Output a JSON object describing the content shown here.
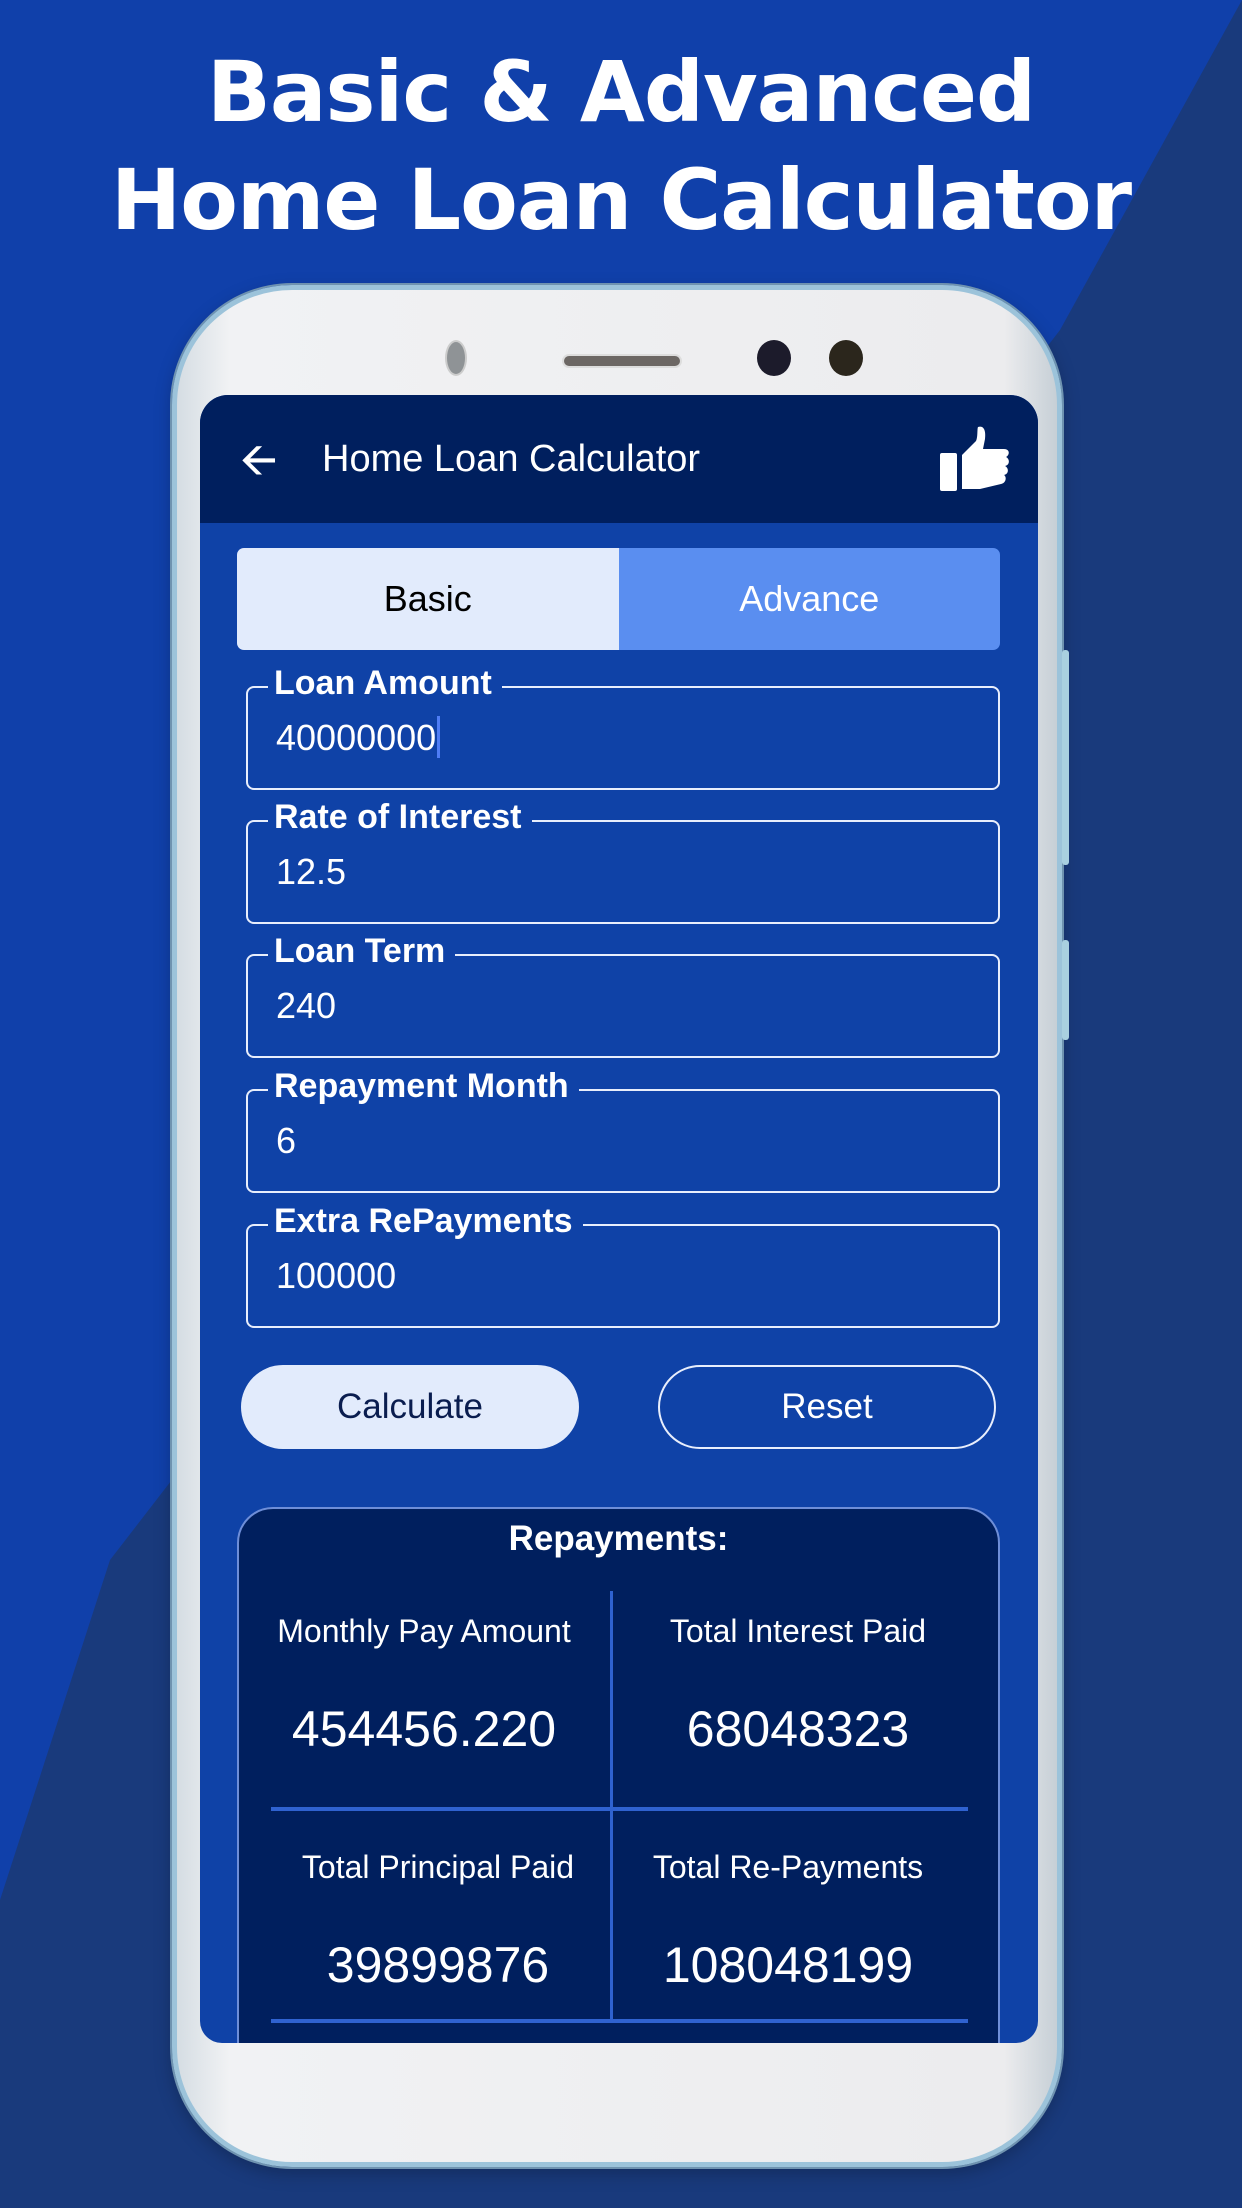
{
  "headline": {
    "line1": "Basic & Advanced",
    "line2": "Home Loan Calculator"
  },
  "app": {
    "title": "Home Loan Calculator",
    "back_icon": "arrow-left-icon",
    "like_icon": "thumbs-up-icon"
  },
  "tabs": [
    {
      "label": "Basic",
      "active": true
    },
    {
      "label": "Advance",
      "active": false
    }
  ],
  "fields": [
    {
      "label": "Loan Amount",
      "value": "40000000"
    },
    {
      "label": "Rate of Interest",
      "value": "12.5"
    },
    {
      "label": "Loan Term",
      "value": "240"
    },
    {
      "label": "Repayment Month",
      "value": "6"
    },
    {
      "label": "Extra RePayments",
      "value": "100000"
    }
  ],
  "buttons": {
    "calculate": "Calculate",
    "reset": "Reset"
  },
  "results": {
    "title": "Repayments:",
    "items": [
      {
        "label": "Monthly Pay Amount",
        "value": "454456.220"
      },
      {
        "label": "Total Interest Paid",
        "value": "68048323"
      },
      {
        "label": "Total Principal Paid",
        "value": "39899876"
      },
      {
        "label": "Total Re-Payments",
        "value": "108048199"
      }
    ]
  },
  "colors": {
    "background": "#1040aa",
    "appbar": "#001f5e",
    "screen": "#0f42a7",
    "tab_active": "#e2ebfc",
    "tab_inactive": "#5a8ef0",
    "divider": "#2f62d0"
  }
}
